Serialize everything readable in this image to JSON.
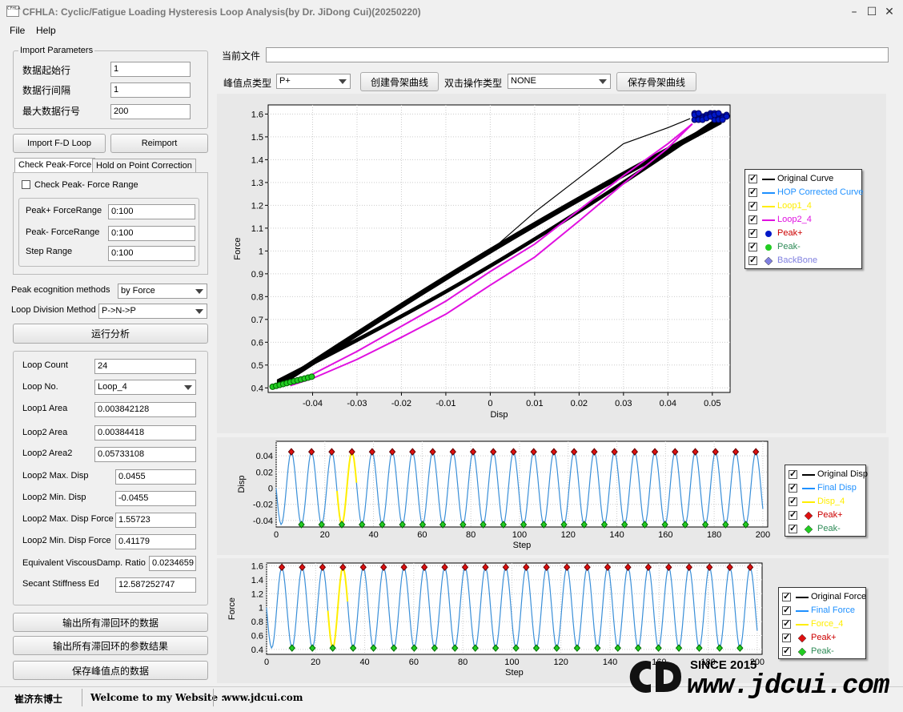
{
  "window": {
    "title": "CFHLA: Cyclic/Fatigue Loading Hysteresis Loop Analysis(by Dr. JiDong Cui)(20250220)",
    "icon_text": "CFHLA"
  },
  "menu": {
    "file": "File",
    "help": "Help"
  },
  "import_params": {
    "legend": "Import Parameters",
    "start_row_label": "数据起始行",
    "start_row": "1",
    "interval_label": "数据行间隔",
    "interval": "1",
    "max_row_label": "最大数据行号",
    "max_row": "200"
  },
  "buttons": {
    "import": "Import F-D Loop",
    "reimport": "Reimport",
    "run": "运行分析",
    "export_loops": "输出所有滞回环的数据",
    "export_params": "输出所有滞回环的参数结果",
    "save_peaks": "保存峰值点的数据",
    "create_backbone": "创建骨架曲线",
    "save_backbone": "保存骨架曲线"
  },
  "tabs": {
    "check": "Check Peak-Force",
    "hold": "Hold on Point Correction"
  },
  "check_panel": {
    "checkbox_label": "Check Peak- Force Range",
    "peak_plus_label": "Peak+ ForceRange",
    "peak_plus": "0:100",
    "peak_minus_label": "Peak- ForceRange",
    "peak_minus": "0:100",
    "step_label": "Step Range",
    "step": "0:100"
  },
  "methods": {
    "recog_label": "Peak ecognition methods",
    "recog_value": "by Force",
    "division_label": "Loop Division Method",
    "division_value": "P->N->P"
  },
  "results": {
    "loop_count_label": "Loop Count",
    "loop_count": "24",
    "loop_no_label": "Loop No.",
    "loop_no": "Loop_4",
    "loop1_area_label": "Loop1 Area",
    "loop1_area": "0.003842128",
    "loop2_area_label": "Loop2 Area",
    "loop2_area": "0.00384418",
    "loop2_area2_label": "Loop2 Area2",
    "loop2_area2": "0.05733108",
    "max_disp_label": "Loop2 Max. Disp",
    "max_disp": "0.0455",
    "min_disp_label": "Loop2 Min. Disp",
    "min_disp": "-0.0455",
    "max_force_label": "Loop2 Max. Disp Force",
    "max_force": "1.55723",
    "min_force_label": "Loop2 Min. Disp Force",
    "min_force": "0.41179",
    "damp_label": "Equivalent ViscousDamp. Ratio",
    "damp": "0.0234659",
    "stiff_label": "Secant Stiffness Ed",
    "stiff": "12.587252747"
  },
  "top": {
    "file_label": "当前文件",
    "file_value": "",
    "peak_type_label": "峰值点类型",
    "peak_type": "P+",
    "dblclick_label": "双击操作类型",
    "dblclick": "NONE"
  },
  "legend_main": {
    "items": [
      {
        "label": "Original Curve",
        "color": "#000000",
        "kind": "line"
      },
      {
        "label": "HOP Corrected Curve",
        "color": "#1e90ff",
        "kind": "line"
      },
      {
        "label": "Loop1_4",
        "color": "#ffee00",
        "kind": "line"
      },
      {
        "label": "Loop2_4",
        "color": "#e010e0",
        "kind": "line"
      },
      {
        "label": "Peak+",
        "color": "#cc0000",
        "kind": "dot"
      },
      {
        "label": "Peak-",
        "color": "#2e8b57",
        "kind": "dot"
      },
      {
        "label": "BackBone",
        "color": "#8080e0",
        "kind": "diamond"
      }
    ]
  },
  "legend_disp": {
    "items": [
      {
        "label": "Original Disp",
        "color": "#000000",
        "kind": "line"
      },
      {
        "label": "Final Disp",
        "color": "#1e90ff",
        "kind": "line"
      },
      {
        "label": "Disp_4",
        "color": "#ffee00",
        "kind": "line"
      },
      {
        "label": "Peak+",
        "color": "#cc0000",
        "kind": "diamond"
      },
      {
        "label": "Peak-",
        "color": "#2e8b57",
        "kind": "diamond"
      }
    ]
  },
  "legend_force": {
    "items": [
      {
        "label": "Original Force",
        "color": "#000000",
        "kind": "line"
      },
      {
        "label": "Final Force",
        "color": "#1e90ff",
        "kind": "line"
      },
      {
        "label": "Force_4",
        "color": "#ffee00",
        "kind": "line"
      },
      {
        "label": "Peak+",
        "color": "#cc0000",
        "kind": "diamond"
      },
      {
        "label": "Peak-",
        "color": "#2e8b57",
        "kind": "diamond"
      }
    ]
  },
  "status": {
    "author": "崔济东博士",
    "welcome": "Welcome to my Website :",
    "site": "www.jdcui.com"
  },
  "watermark": {
    "since": "SINCE 2015",
    "url": "www.jdcui.com"
  },
  "chart_data": [
    {
      "type": "line",
      "title": "",
      "xlabel": "Disp",
      "ylabel": "Force",
      "xlim": [
        -0.05,
        0.054
      ],
      "ylim": [
        0.38,
        1.64
      ],
      "xticks": [
        "-0.04",
        "-0.03",
        "-0.02",
        "-0.01",
        "0",
        "0.01",
        "0.02",
        "0.03",
        "0.04",
        "0.05"
      ],
      "yticks": [
        "0.4",
        "0.5",
        "0.6",
        "0.7",
        "0.8",
        "0.9",
        "1",
        "1.1",
        "1.2",
        "1.3",
        "1.4",
        "1.5",
        "1.6"
      ],
      "series": [
        {
          "name": "Original Curve",
          "x": [
            0.0,
            0.01,
            0.02,
            0.03,
            0.04,
            0.045
          ],
          "y": [
            1.0,
            1.17,
            1.32,
            1.47,
            1.54,
            1.58
          ]
        },
        {
          "name": "Loop2_4",
          "x": [
            -0.045,
            -0.04,
            -0.03,
            -0.02,
            -0.01,
            0.0,
            0.01,
            0.02,
            0.03,
            0.04,
            0.0455
          ],
          "y": [
            0.41,
            0.46,
            0.56,
            0.67,
            0.78,
            0.91,
            1.03,
            1.18,
            1.33,
            1.47,
            1.557
          ]
        }
      ]
    },
    {
      "type": "line",
      "title": "",
      "xlabel": "Step",
      "ylabel": "Disp",
      "xlim": [
        0,
        202
      ],
      "ylim": [
        -0.048,
        0.058
      ],
      "xticks": [
        "0",
        "20",
        "40",
        "60",
        "80",
        "100",
        "120",
        "140",
        "160",
        "180",
        "200"
      ],
      "yticks": [
        "0.04",
        "0.02",
        "0",
        "-0.02",
        "-0.04"
      ],
      "series": [
        {
          "name": "Final Disp",
          "period": 8.3,
          "amplitude": 0.045
        }
      ]
    },
    {
      "type": "line",
      "title": "",
      "xlabel": "Step",
      "ylabel": "Force",
      "xlim": [
        0,
        202
      ],
      "ylim": [
        0.33,
        1.64
      ],
      "xticks": [
        "0",
        "20",
        "40",
        "60",
        "80",
        "100",
        "120",
        "140",
        "160",
        "180",
        "200"
      ],
      "yticks": [
        "1.6",
        "1.4",
        "1.2",
        "1",
        "0.8",
        "0.6",
        "0.4"
      ],
      "series": [
        {
          "name": "Final Force",
          "period": 8.3,
          "center": 1.0,
          "amplitude": 0.58
        }
      ]
    }
  ]
}
